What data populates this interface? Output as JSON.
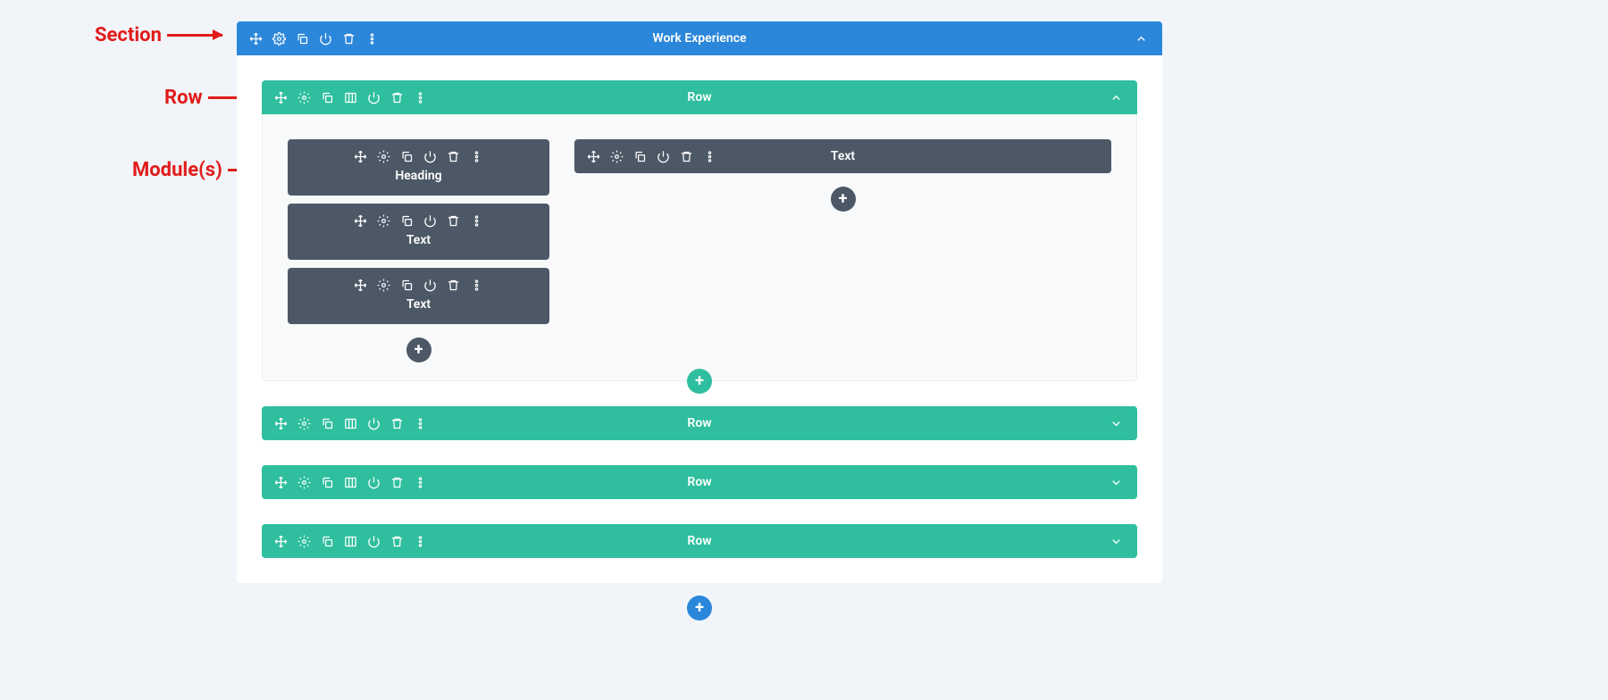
{
  "annotations": {
    "section": "Section",
    "row": "Row",
    "modules": "Module(s)"
  },
  "section": {
    "title": "Work Experience",
    "row_expanded": {
      "title": "Row",
      "left_column": {
        "modules": [
          {
            "label": "Heading"
          },
          {
            "label": "Text"
          },
          {
            "label": "Text"
          }
        ],
        "add_label": "+"
      },
      "right_column": {
        "modules": [
          {
            "label": "Text"
          }
        ],
        "add_label": "+"
      }
    },
    "add_row_label": "+",
    "collapsed_rows": [
      {
        "title": "Row"
      },
      {
        "title": "Row"
      },
      {
        "title": "Row"
      }
    ],
    "add_section_label": "+"
  }
}
